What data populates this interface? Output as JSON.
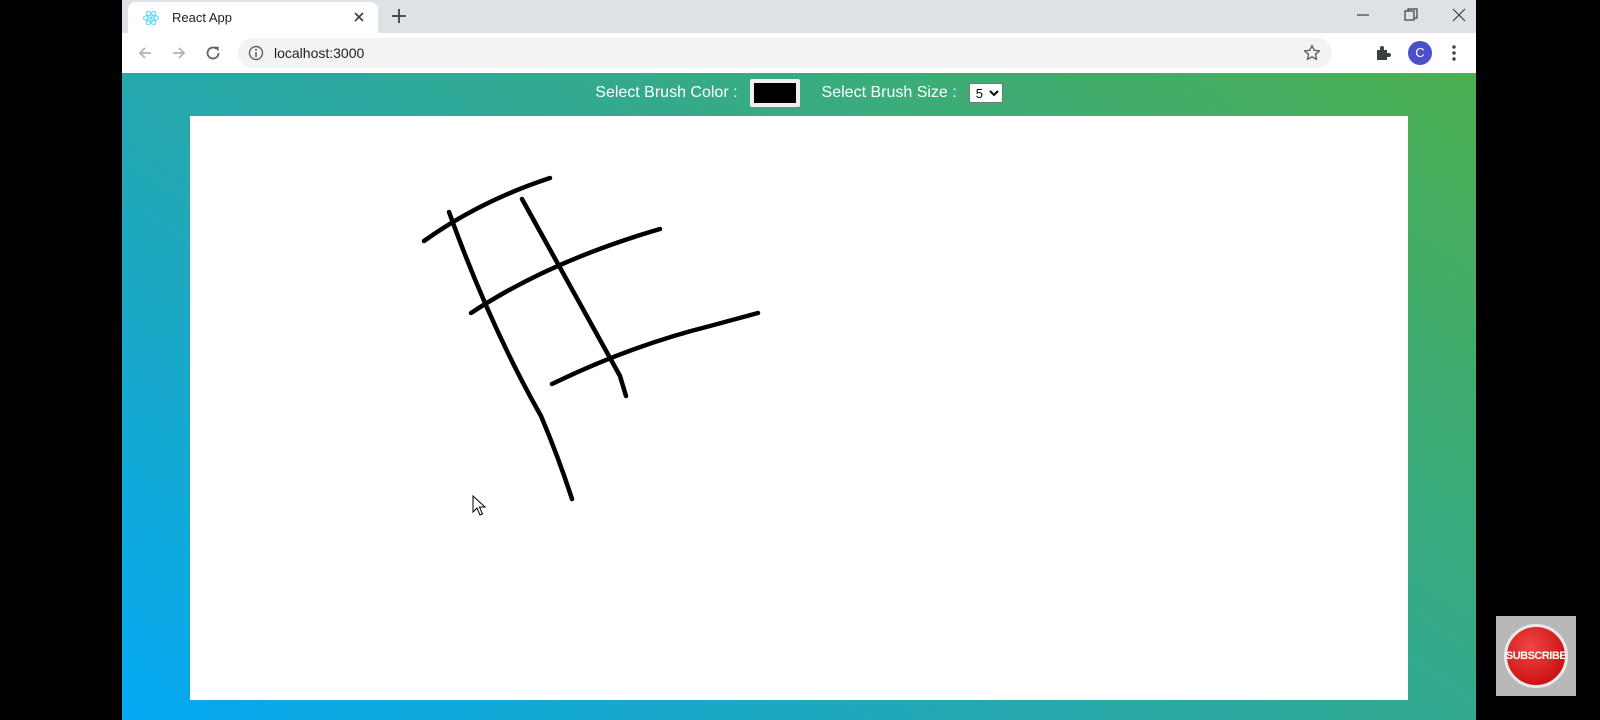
{
  "browser": {
    "tab": {
      "title": "React App",
      "favicon": "react-logo"
    },
    "url": "localhost:3000",
    "profile_initial": "C"
  },
  "app": {
    "brush_color_label": "Select Brush Color :",
    "brush_color": "#000000",
    "brush_size_label": "Select Brush Size :",
    "brush_size": "5"
  },
  "overlay": {
    "subscribe_label": "SUBSCRIBE"
  },
  "colors": {
    "gradient_start": "#03a9f4",
    "gradient_mid": "#2aa8a6",
    "gradient_end": "#4caf50",
    "canvas_bg": "#ffffff",
    "subscribe_red": "#d01010"
  }
}
